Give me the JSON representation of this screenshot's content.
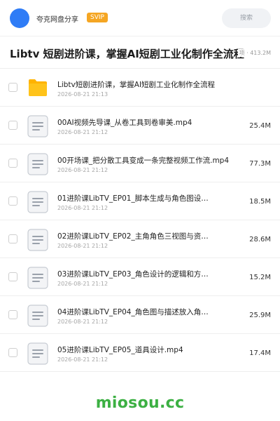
{
  "header": {
    "user_name": "夸克网盘分享",
    "vip_badge": "SVIP",
    "search_label": "搜索"
  },
  "folder": {
    "title": "Libtv 短剧进阶课，掌握AI短剧工业化制作全流程",
    "meta": "项 · 413.2M"
  },
  "files": [
    {
      "name": "Libtv短剧进阶课，掌握AI短剧工业化制作全流程",
      "date": "2026-08-21 21:13",
      "size": "",
      "type": "folder-icon"
    },
    {
      "name": "00AI视频先导课_从卷工具到卷审美.mp4",
      "date": "2026-08-21 21:12",
      "size": "25.4M",
      "type": "video-file-icon"
    },
    {
      "name": "00开场课_把分散工具变成一条完整视频工作流.mp4",
      "date": "2026-08-21 21:12",
      "size": "77.3M",
      "type": "video-file-icon"
    },
    {
      "name": "01进阶课LibTV_EP01_脚本生成与角色图设…",
      "date": "2026-08-21 21:12",
      "size": "18.5M",
      "type": "video-file-icon"
    },
    {
      "name": "02进阶课LibTV_EP02_主角角色三视图与资…",
      "date": "2026-08-21 21:12",
      "size": "28.6M",
      "type": "video-file-icon"
    },
    {
      "name": "03进阶课LibTV_EP03_角色设计的逻辑和方…",
      "date": "2026-08-21 21:12",
      "size": "15.2M",
      "type": "video-file-icon"
    },
    {
      "name": "04进阶课LibTV_EP04_角色图与描述放入角…",
      "date": "2026-08-21 21:12",
      "size": "25.9M",
      "type": "video-file-icon"
    },
    {
      "name": "05进阶课LibTV_EP05_道具设计.mp4",
      "date": "2026-08-21 21:12",
      "size": "17.4M",
      "type": "video-file-icon"
    }
  ],
  "watermark": "miosou.cc",
  "colors": {
    "avatar": "#2f7cf6",
    "vip_badge": "#f5a623",
    "folder": "#ffc31a",
    "watermark": "#3cb043"
  }
}
